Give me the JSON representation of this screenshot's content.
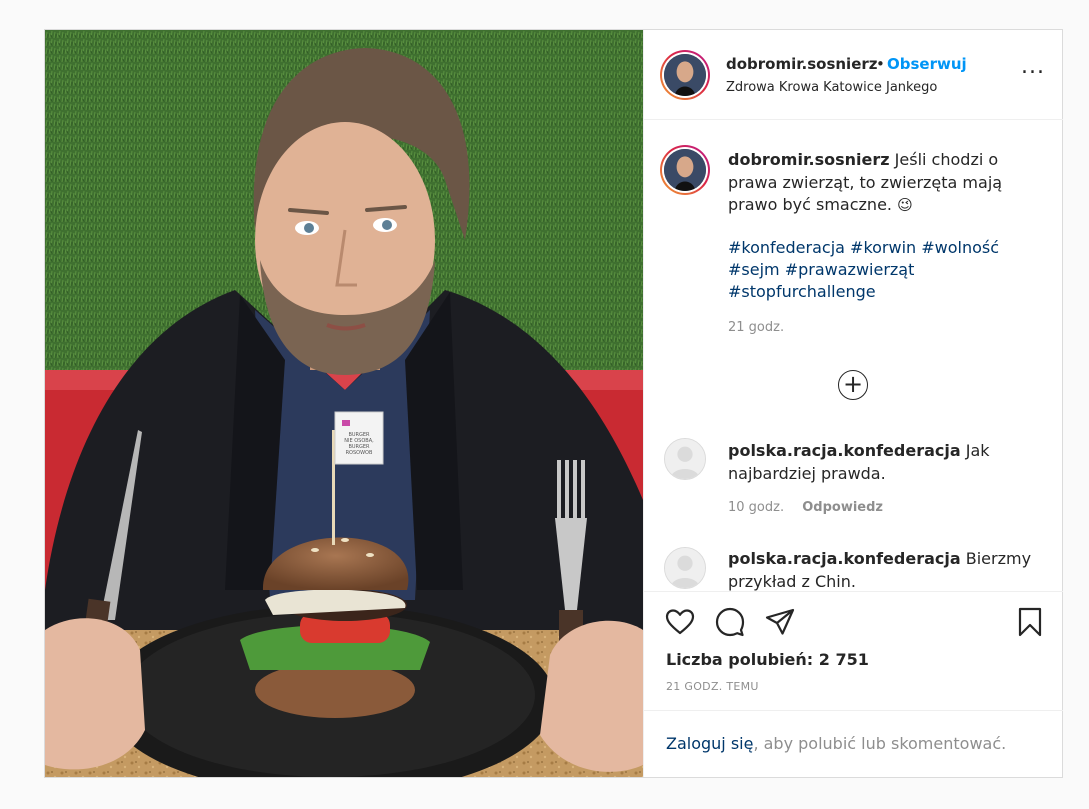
{
  "post": {
    "username": "dobromir.sosnierz",
    "separator": "•",
    "follow_label": "Obserwuj",
    "location": "Zdrowa Krowa Katowice Jankego",
    "more_label": "...",
    "flag_text": [
      "BURGER",
      "NIE OSOBA,",
      "BURGER ROSOWOB"
    ]
  },
  "caption": {
    "username": "dobromir.sosnierz",
    "text": " Jeśli chodzi o prawa zwierząt, to zwierzęta mają prawo być smaczne. ",
    "emoji": "😉",
    "hashtags": [
      "#konfederacja",
      "#korwin",
      "#wolność",
      "#sejm",
      "#prawazwierząt",
      "#stopfurchallenge"
    ],
    "time": "21 godz."
  },
  "load_more_icon": "plus-circle-icon",
  "comments": [
    {
      "username": "polska.racja.konfederacja",
      "text": " Jak najbardziej prawda.",
      "time": "10 godz.",
      "reply": "Odpowiedz"
    },
    {
      "username": "polska.racja.konfederacja",
      "text": " Bierzmy przykład z Chin.",
      "time": "",
      "reply": ""
    }
  ],
  "actions": {
    "icons": [
      "heart-icon",
      "comment-icon",
      "share-icon",
      "bookmark-icon"
    ],
    "likes": "Liczba polubień: 2 751",
    "posted": "21 GODZ. TEMU"
  },
  "login": {
    "link": "Zaloguj się",
    "rest": ", aby polubić lub skomentować."
  },
  "colors": {
    "follow": "#0095f6",
    "hashtag": "#00376b",
    "muted": "#8e8e8e",
    "border": "#dbdbdb"
  }
}
